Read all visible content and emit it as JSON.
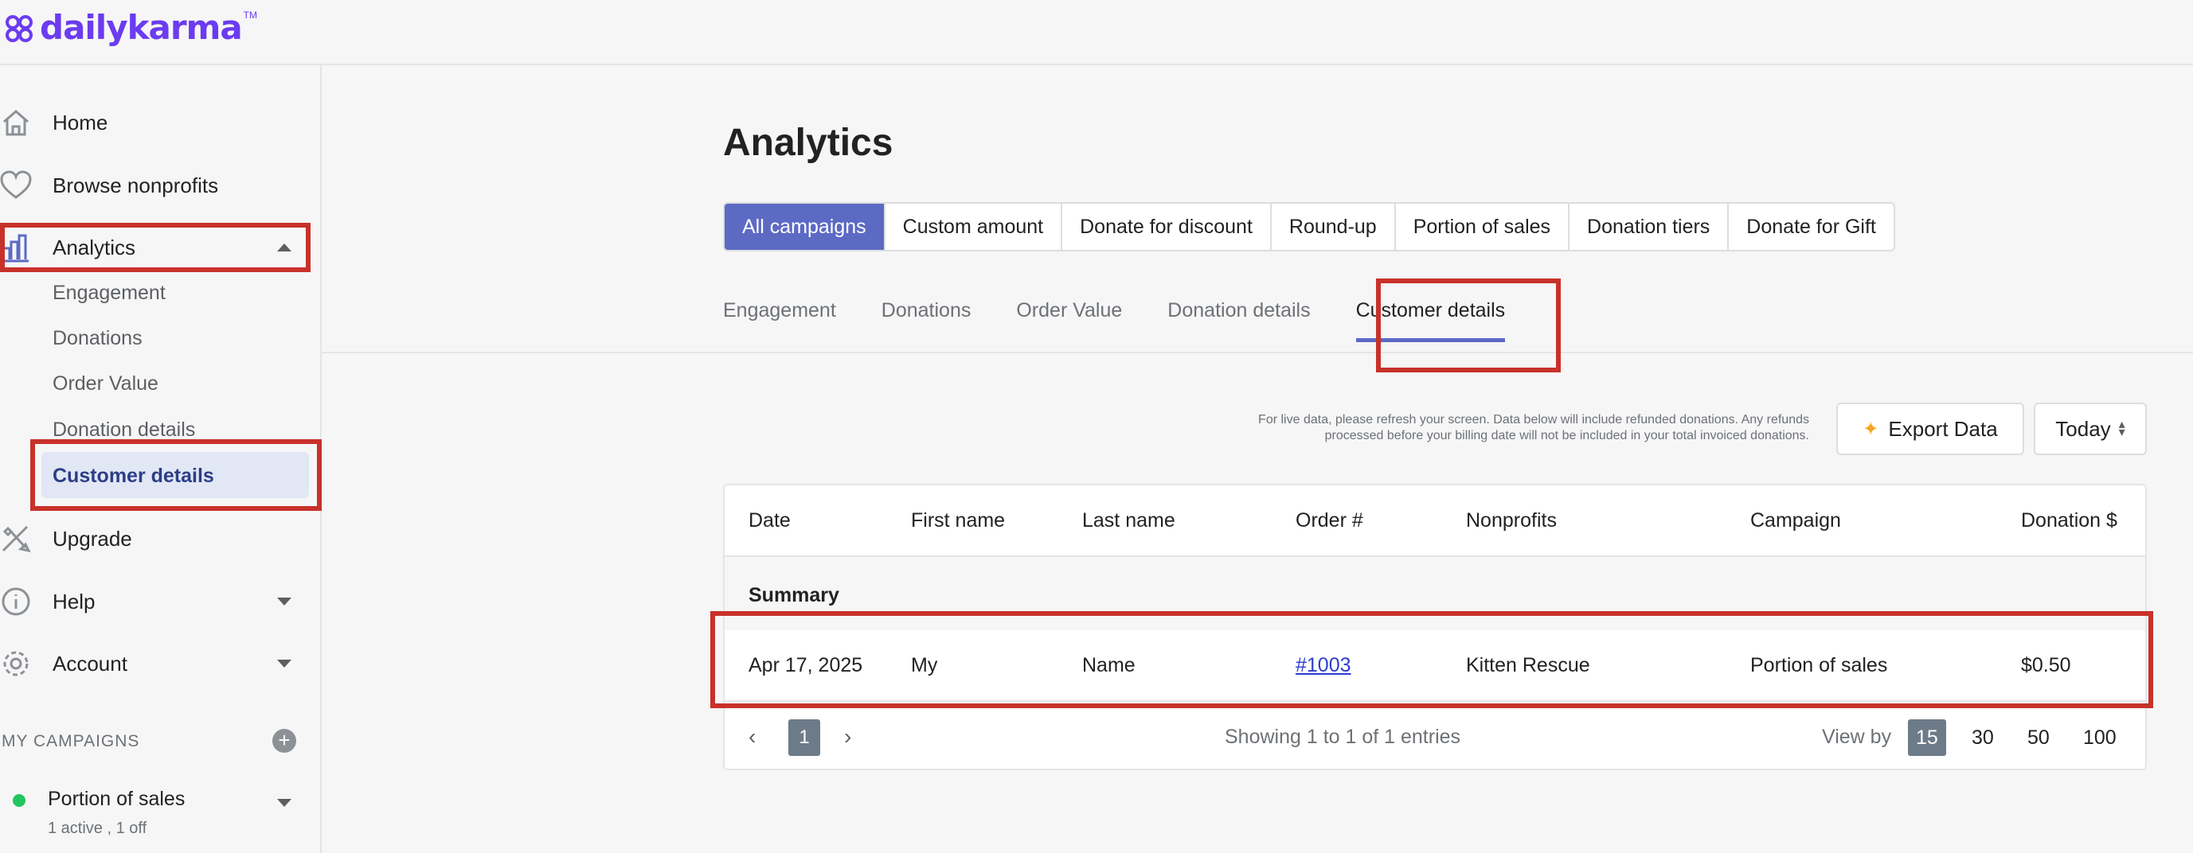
{
  "brand": {
    "name": "dailykarma",
    "tm": "TM",
    "color": "#6b3cf0"
  },
  "sidebar": {
    "items": [
      {
        "label": "Home",
        "icon": "home-icon"
      },
      {
        "label": "Browse nonprofits",
        "icon": "heart-icon"
      },
      {
        "label": "Analytics",
        "icon": "bar-chart-icon"
      },
      {
        "label": "Upgrade",
        "icon": "tools-icon"
      },
      {
        "label": "Help",
        "icon": "info-icon"
      },
      {
        "label": "Account",
        "icon": "gear-icon"
      }
    ],
    "analytics_sub": [
      "Engagement",
      "Donations",
      "Order Value",
      "Donation details",
      "Customer details"
    ],
    "my_campaigns_label": "MY CAMPAIGNS",
    "campaign": {
      "name": "Portion of sales",
      "status": "1 active , 1 off"
    }
  },
  "main": {
    "title": "Analytics",
    "campaign_tabs": [
      "All campaigns",
      "Custom amount",
      "Donate for discount",
      "Round-up",
      "Portion of sales",
      "Donation tiers",
      "Donate for Gift"
    ],
    "sub_tabs": [
      "Engagement",
      "Donations",
      "Order Value",
      "Donation details",
      "Customer details"
    ],
    "notice_line1": "For live data, please refresh your screen. Data below will include refunded donations. Any refunds",
    "notice_line2": "processed before your billing date will not be included in your total invoiced donations.",
    "export_label": "Export Data",
    "range_label": "Today",
    "table": {
      "headers": [
        "Date",
        "First name",
        "Last name",
        "Order #",
        "Nonprofits",
        "Campaign",
        "Donation $"
      ],
      "summary_label": "Summary",
      "rows": [
        [
          "Apr 17, 2025",
          "My",
          "Name",
          "#1003",
          "Kitten Rescue",
          "Portion of sales",
          "$0.50"
        ]
      ]
    },
    "pager": {
      "current": "1",
      "showing": "Showing 1 to 1 of 1 entries",
      "view_by_label": "View by",
      "sizes": [
        "15",
        "30",
        "50",
        "100"
      ]
    }
  },
  "colors": {
    "accent": "#5c6ac4",
    "highlight": "#c8312a",
    "active_dot": "#22c55e"
  }
}
